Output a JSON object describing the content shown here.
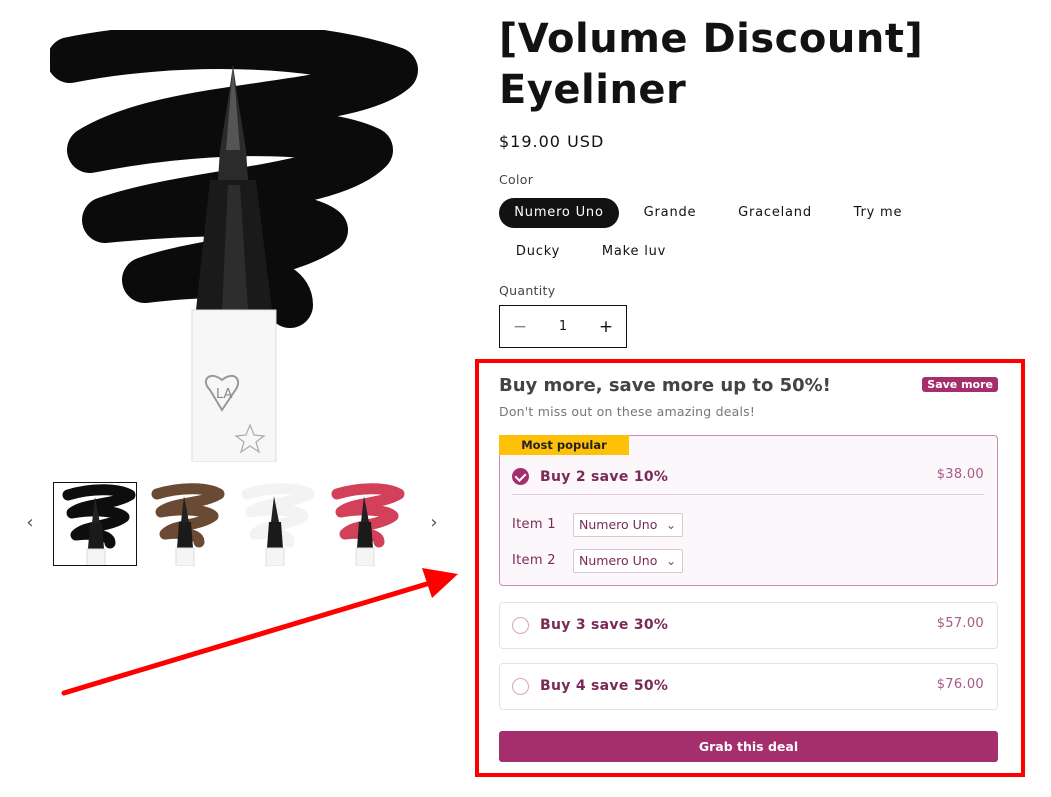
{
  "product": {
    "title": "[Volume Discount] Eyeliner",
    "price": "$19.00 USD"
  },
  "gallery": {
    "thumbnails": [
      {
        "shade": "black",
        "color": "#0d0d0d",
        "selected": true
      },
      {
        "shade": "brown",
        "color": "#6b4a33",
        "selected": false
      },
      {
        "shade": "white",
        "color": "#f2f2f2",
        "selected": false
      },
      {
        "shade": "red",
        "color": "#d2405a",
        "selected": false
      }
    ],
    "prev_icon": "chevron-left-icon",
    "next_icon": "chevron-right-icon",
    "logo_text": "LA"
  },
  "color_option": {
    "label": "Color",
    "values": [
      "Numero Uno",
      "Grande",
      "Graceland",
      "Try me",
      "Ducky",
      "Make luv"
    ],
    "selected": "Numero Uno"
  },
  "quantity": {
    "label": "Quantity",
    "value": "1",
    "minus": "−",
    "plus": "+"
  },
  "bundle": {
    "heading": "Buy more, save more up to 50%!",
    "subheading": "Don't miss out on these amazing deals!",
    "badge": "Save more",
    "tiers": [
      {
        "tag": "Most popular",
        "label": "Buy 2 save 10%",
        "price": "$38.00",
        "selected": true,
        "items": [
          {
            "label": "Item 1",
            "value": "Numero Uno"
          },
          {
            "label": "Item 2",
            "value": "Numero Uno"
          }
        ]
      },
      {
        "label": "Buy 3 save 30%",
        "price": "$57.00",
        "selected": false
      },
      {
        "label": "Buy 4 save 50%",
        "price": "$76.00",
        "selected": false
      }
    ],
    "cta": "Grab this deal",
    "accent_color": "#a52f6d",
    "tag_color": "#ffc107"
  },
  "annotation": {
    "highlight_color": "#ff0000"
  }
}
